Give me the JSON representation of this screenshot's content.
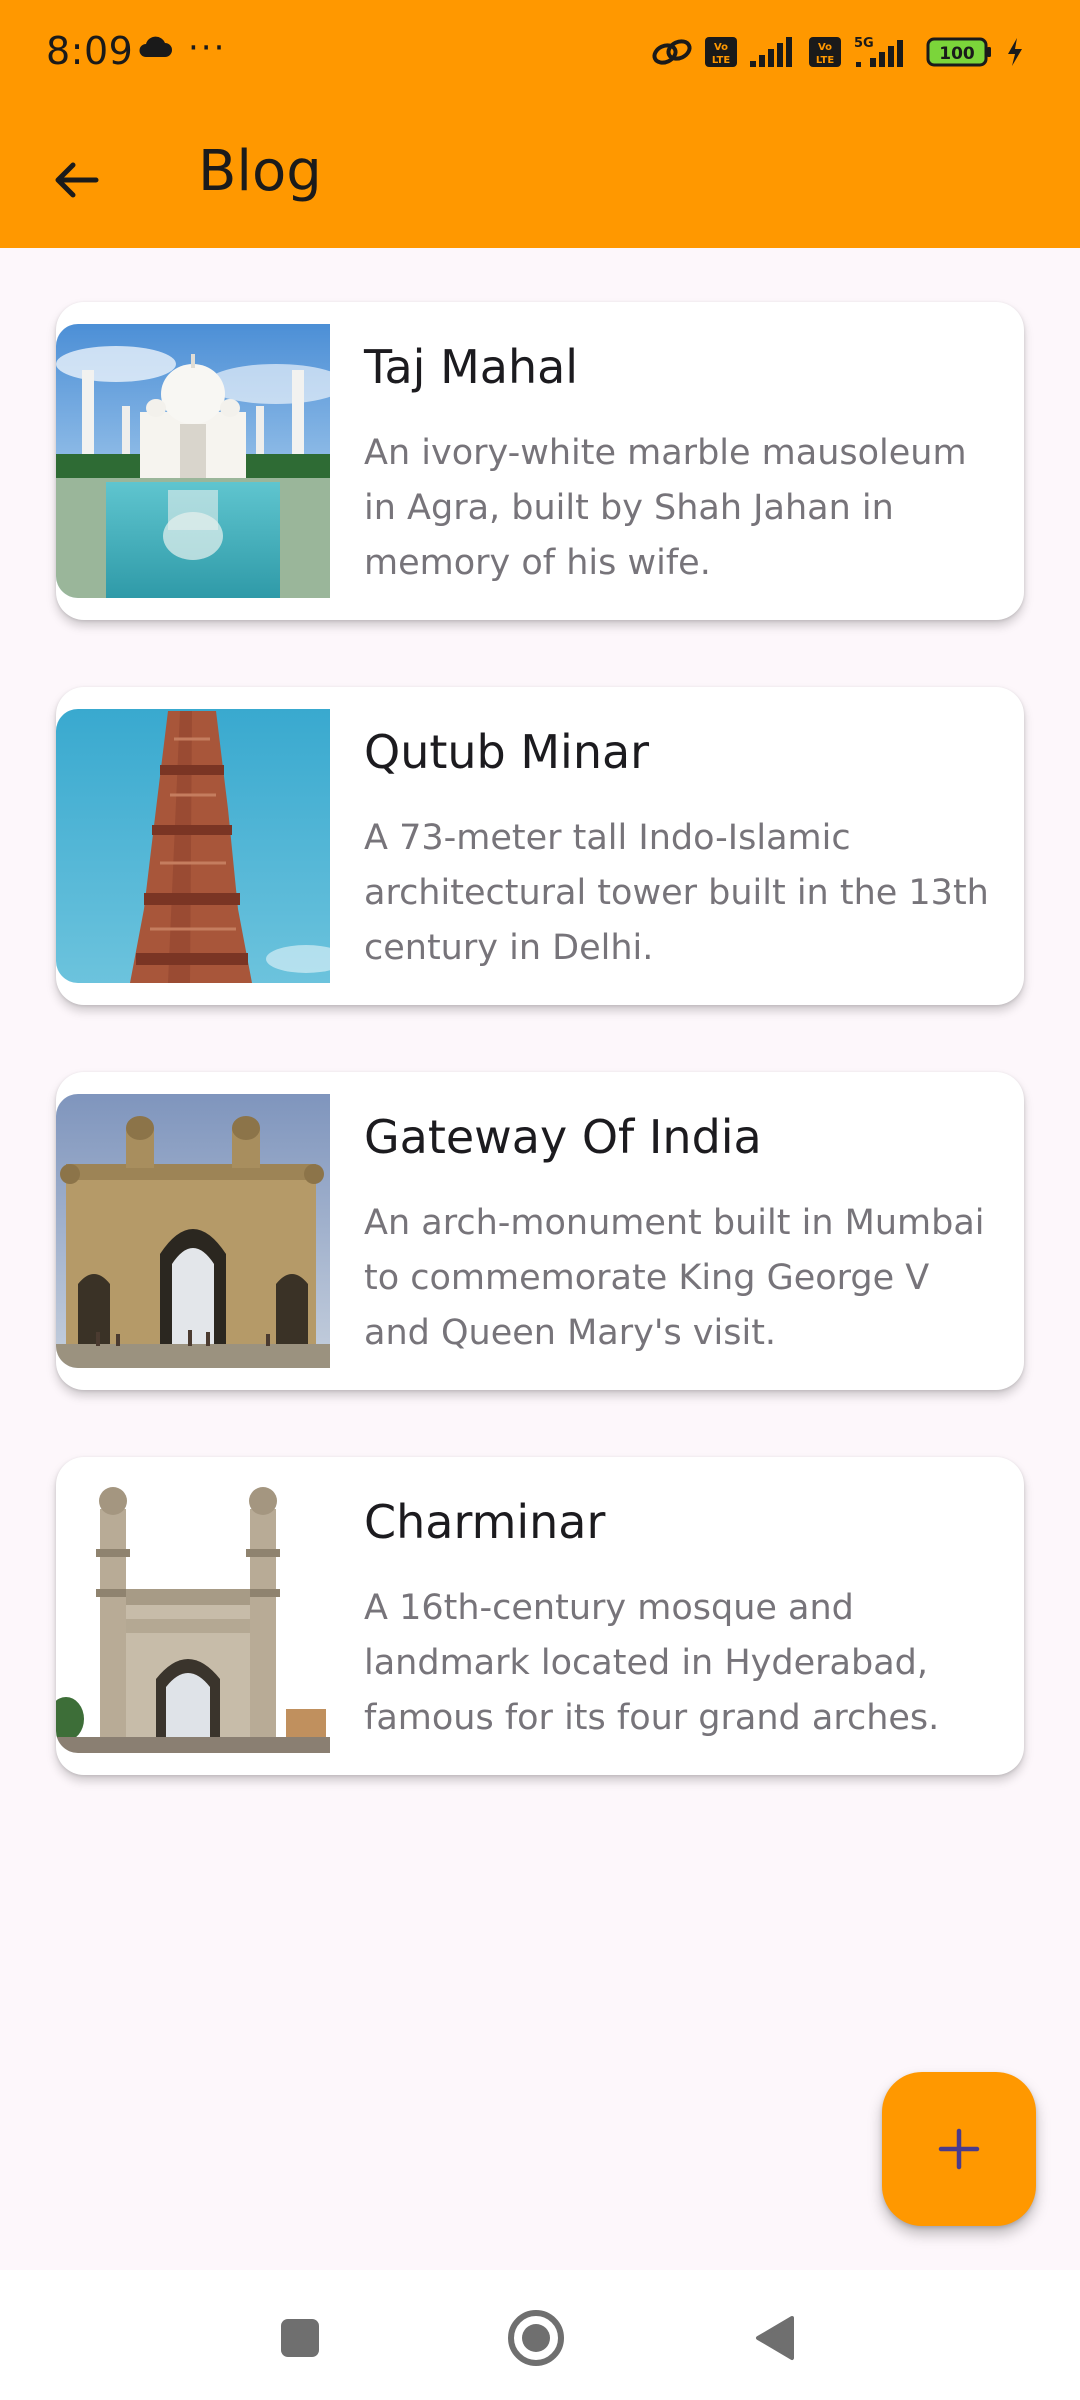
{
  "status_bar": {
    "time": "8:09",
    "more": "···",
    "volte_label": "Vo LTE",
    "network_label": "5G",
    "battery_level": "100"
  },
  "app_bar": {
    "title": "Blog"
  },
  "posts": [
    {
      "title": "Taj Mahal",
      "description": "An ivory-white marble mausoleum in Agra, built by Shah Jahan in memory of his wife.",
      "image": "taj-mahal-photo"
    },
    {
      "title": "Qutub Minar",
      "description": "A 73-meter tall Indo-Islamic architectural tower built in the 13th century in Delhi.",
      "image": "qutub-minar-photo"
    },
    {
      "title": "Gateway Of India",
      "description": "An arch-monument built in Mumbai to commemorate King George V and Queen Mary's visit.",
      "image": "gateway-of-india-photo"
    },
    {
      "title": "Charminar",
      "description": "A 16th-century mosque and landmark located in Hyderabad, famous for its four grand arches.",
      "image": "charminar-photo"
    }
  ],
  "fab": {
    "icon": "plus-icon"
  },
  "nav_bar": {
    "icons": [
      "recents-icon",
      "home-icon",
      "back-icon"
    ]
  },
  "colors": {
    "primary": "#ff9800",
    "background": "#fdf7fb",
    "card": "#ffffff",
    "title_text": "#1c1b1f",
    "body_text": "#77747a",
    "fab_icon": "#4a3b8c"
  }
}
